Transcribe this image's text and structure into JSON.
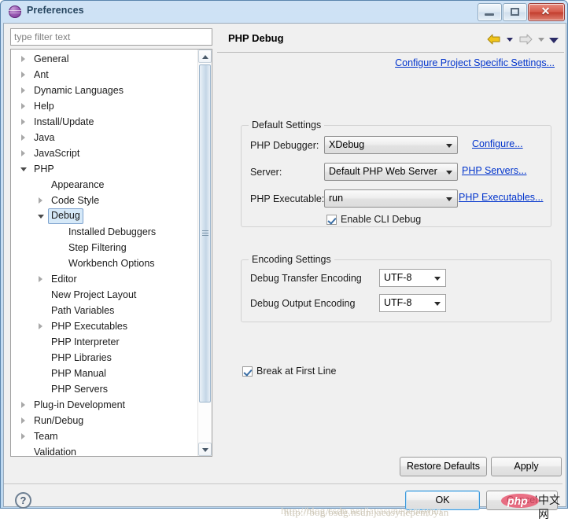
{
  "window": {
    "title": "Preferences",
    "icon": "preferences-sphere-icon",
    "buttons": {
      "minimize": "minimize-button",
      "restore": "restore-button",
      "close_glyph": "✕"
    }
  },
  "filter": {
    "placeholder": "type filter text",
    "value": ""
  },
  "tree": {
    "items": [
      {
        "label": "General",
        "indent": 0,
        "arrow": "collapsed",
        "selected": false
      },
      {
        "label": "Ant",
        "indent": 0,
        "arrow": "collapsed",
        "selected": false
      },
      {
        "label": "Dynamic Languages",
        "indent": 0,
        "arrow": "collapsed",
        "selected": false
      },
      {
        "label": "Help",
        "indent": 0,
        "arrow": "collapsed",
        "selected": false
      },
      {
        "label": "Install/Update",
        "indent": 0,
        "arrow": "collapsed",
        "selected": false
      },
      {
        "label": "Java",
        "indent": 0,
        "arrow": "collapsed",
        "selected": false
      },
      {
        "label": "JavaScript",
        "indent": 0,
        "arrow": "collapsed",
        "selected": false
      },
      {
        "label": "PHP",
        "indent": 0,
        "arrow": "expanded",
        "selected": false
      },
      {
        "label": "Appearance",
        "indent": 1,
        "arrow": "none",
        "selected": false
      },
      {
        "label": "Code Style",
        "indent": 1,
        "arrow": "collapsed",
        "selected": false
      },
      {
        "label": "Debug",
        "indent": 1,
        "arrow": "expanded",
        "selected": true
      },
      {
        "label": "Installed Debuggers",
        "indent": 2,
        "arrow": "none",
        "selected": false
      },
      {
        "label": "Step Filtering",
        "indent": 2,
        "arrow": "none",
        "selected": false
      },
      {
        "label": "Workbench Options",
        "indent": 2,
        "arrow": "none",
        "selected": false
      },
      {
        "label": "Editor",
        "indent": 1,
        "arrow": "collapsed",
        "selected": false
      },
      {
        "label": "New Project Layout",
        "indent": 1,
        "arrow": "none",
        "selected": false
      },
      {
        "label": "Path Variables",
        "indent": 1,
        "arrow": "none",
        "selected": false
      },
      {
        "label": "PHP Executables",
        "indent": 1,
        "arrow": "collapsed",
        "selected": false
      },
      {
        "label": "PHP Interpreter",
        "indent": 1,
        "arrow": "none",
        "selected": false
      },
      {
        "label": "PHP Libraries",
        "indent": 1,
        "arrow": "none",
        "selected": false
      },
      {
        "label": "PHP Manual",
        "indent": 1,
        "arrow": "none",
        "selected": false
      },
      {
        "label": "PHP Servers",
        "indent": 1,
        "arrow": "none",
        "selected": false
      },
      {
        "label": "Plug-in Development",
        "indent": 0,
        "arrow": "collapsed",
        "selected": false
      },
      {
        "label": "Run/Debug",
        "indent": 0,
        "arrow": "collapsed",
        "selected": false
      },
      {
        "label": "Team",
        "indent": 0,
        "arrow": "collapsed",
        "selected": false
      },
      {
        "label": "Validation",
        "indent": 0,
        "arrow": "none",
        "selected": false
      }
    ]
  },
  "page": {
    "title": "PHP Debug",
    "nav": {
      "back": "back-arrow-icon",
      "back_menu": "back-dropdown-icon",
      "forward": "forward-arrow-icon",
      "forward_menu": "forward-dropdown-icon",
      "view_menu": "view-menu-icon"
    },
    "configure_project_link": "Configure Project Specific Settings...",
    "default_settings": {
      "legend": "Default Settings",
      "rows": [
        {
          "label": "PHP Debugger:",
          "value": "XDebug",
          "link": "Configure..."
        },
        {
          "label": "Server:",
          "value": "Default PHP Web Server",
          "link": "PHP Servers..."
        },
        {
          "label": "PHP Executable:",
          "value": "run",
          "link": "PHP Executables..."
        }
      ],
      "checkbox": {
        "label": "Enable CLI Debug",
        "checked": true
      }
    },
    "encoding_settings": {
      "legend": "Encoding Settings",
      "rows": [
        {
          "label": "Debug Transfer Encoding",
          "value": "UTF-8"
        },
        {
          "label": "Debug Output Encoding",
          "value": "UTF-8"
        }
      ]
    },
    "break_first_line": {
      "label": "Break at First Line",
      "checked": true
    },
    "restore_defaults_label": "Restore Defaults",
    "apply_label": "Apply"
  },
  "footer": {
    "help": "?",
    "ok_label": "OK",
    "cancel_label": "Cancel"
  },
  "watermark": {
    "url_line_a": "http://blog.csdn.net/javasynepemoyan",
    "url_line_b": "http://bog/bsdg.nsdn.jaeasynepem0yan",
    "logo_php": "php",
    "logo_cn": "中文网"
  },
  "colors": {
    "accent_link": "#0033cc",
    "title_text": "#26455f",
    "selection": "#d6e9f8",
    "close_button": "#c23d2e"
  }
}
